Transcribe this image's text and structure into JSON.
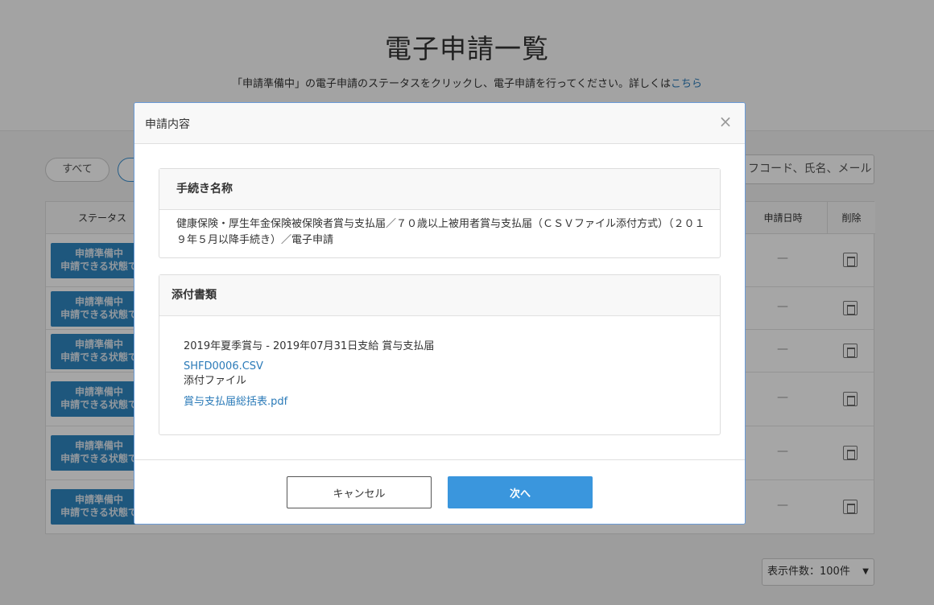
{
  "page": {
    "title": "電子申請一覧",
    "description": "「申請準備中」の電子申請のステータスをクリックし、電子申請を行ってください。詳しくは",
    "description_link": "こちら",
    "filter_all": "すべて",
    "search_placeholder": "フコード、氏名、メール",
    "columns": {
      "status": "ステータス",
      "date": "申請日時",
      "delete": "削除"
    },
    "rows": [
      {
        "status": "申請準備中",
        "sub": "申請できる状態で",
        "date": "—"
      },
      {
        "status": "申請準備中",
        "sub": "申請できる状態で",
        "date": "—"
      },
      {
        "status": "申請準備中",
        "sub": "申請できる状態で",
        "date": "—"
      },
      {
        "status": "申請準備中",
        "sub": "申請できる状態で",
        "date": "—"
      },
      {
        "status": "申請準備中",
        "sub": "申請できる状態で",
        "date": "—"
      },
      {
        "status": "申請準備中",
        "sub": "申請できる状態で",
        "date": "—"
      }
    ],
    "page_size": "表示件数：100件",
    "page_size_caret": "▼"
  },
  "modal": {
    "title": "申請内容",
    "close": "×",
    "procedure": {
      "heading": "手続き名称",
      "text": "健康保険・厚生年金保険被保険者賞与支払届／７０歳以上被用者賞与支払届（ＣＳＶファイル添付方式）（２０１９年５月以降手続き）／電子申請"
    },
    "attachments": {
      "heading": "添付書類",
      "title": "2019年夏季賞与 - 2019年07月31日支給 賞与支払届",
      "file_link": "SHFD0006.CSV",
      "attached_label": "添付ファイル",
      "summary_link": "賞与支払届総括表.pdf"
    },
    "cancel_label": "キャンセル",
    "next_label": "次へ"
  }
}
